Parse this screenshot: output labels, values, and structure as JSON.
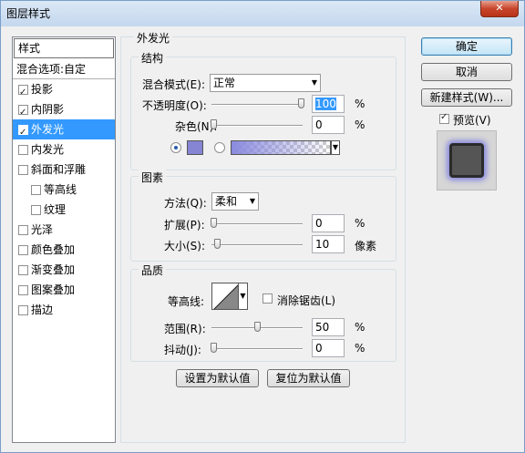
{
  "window": {
    "title": "图层样式",
    "close_label": "✕"
  },
  "sidebar": {
    "header": "样式",
    "blend_options": "混合选项:自定",
    "items": [
      {
        "label": "投影",
        "checked": true
      },
      {
        "label": "内阴影",
        "checked": true
      },
      {
        "label": "外发光",
        "checked": true,
        "active": true
      },
      {
        "label": "内发光",
        "checked": false
      },
      {
        "label": "斜面和浮雕",
        "checked": false
      },
      {
        "label": "等高线",
        "checked": false,
        "sub": true
      },
      {
        "label": "纹理",
        "checked": false,
        "sub": true
      },
      {
        "label": "光泽",
        "checked": false
      },
      {
        "label": "颜色叠加",
        "checked": false
      },
      {
        "label": "渐变叠加",
        "checked": false
      },
      {
        "label": "图案叠加",
        "checked": false
      },
      {
        "label": "描边",
        "checked": false
      }
    ]
  },
  "outer_glow": {
    "title": "外发光",
    "structure": {
      "title": "结构",
      "blend_mode_label": "混合模式(E):",
      "blend_mode_value": "正常",
      "opacity_label": "不透明度(O):",
      "opacity_value": "100",
      "opacity_unit": "%",
      "opacity_level": 1.0,
      "noise_label": "杂色(N):",
      "noise_value": "0",
      "noise_unit": "%",
      "noise_level": 0.0,
      "color": "#8585d4"
    },
    "elements": {
      "title": "图素",
      "technique_label": "方法(Q):",
      "technique_value": "柔和",
      "spread_label": "扩展(P):",
      "spread_value": "0",
      "spread_unit": "%",
      "spread_level": 0.0,
      "size_label": "大小(S):",
      "size_value": "10",
      "size_unit": "像素",
      "size_level": 0.04
    },
    "quality": {
      "title": "品质",
      "contour_label": "等高线:",
      "anti_alias_label": "消除锯齿(L)",
      "anti_alias_checked": false,
      "range_label": "范围(R):",
      "range_value": "50",
      "range_unit": "%",
      "range_level": 0.5,
      "jitter_label": "抖动(J):",
      "jitter_value": "0",
      "jitter_unit": "%",
      "jitter_level": 0.0
    },
    "make_default_label": "设置为默认值",
    "reset_default_label": "复位为默认值"
  },
  "actions": {
    "ok_label": "确定",
    "cancel_label": "取消",
    "new_style_label": "新建样式(W)...",
    "preview_label": "预览(V)",
    "preview_checked": true
  }
}
